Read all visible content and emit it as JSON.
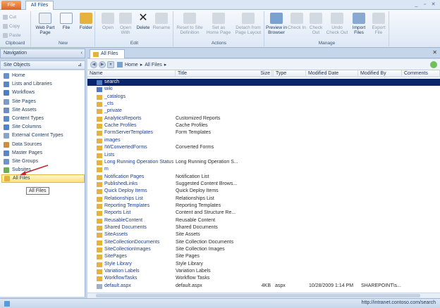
{
  "window": {
    "file_tab": "File",
    "active_tab": "All Files",
    "minimize": "_",
    "restore": "▫",
    "close": "✕",
    "help": "?"
  },
  "ribbon": {
    "clipboard": {
      "label": "Clipboard",
      "cut": "Cut",
      "copy": "Copy",
      "paste": "Paste"
    },
    "new": {
      "label": "New",
      "web_part_page": "Web Part Page",
      "file": "File",
      "folder": "Folder"
    },
    "edit": {
      "label": "Edit",
      "open": "Open",
      "open_with": "Open With",
      "delete": "Delete",
      "rename": "Rename"
    },
    "actions": {
      "label": "Actions",
      "reset": "Reset to Site Definition",
      "set_home": "Set as Home Page",
      "detach": "Detach from Page Layout"
    },
    "manage": {
      "label": "Manage",
      "preview": "Preview in Browser",
      "check_in": "Check In",
      "check_out": "Check Out",
      "undo_check_out": "Undo Check Out",
      "import": "Import Files",
      "export": "Export File"
    }
  },
  "nav": {
    "title": "Navigation",
    "site_objects": "Site Objects",
    "items": [
      {
        "label": "Home",
        "color": "#6b8fc8"
      },
      {
        "label": "Lists and Libraries",
        "color": "#5a86c2"
      },
      {
        "label": "Workflows",
        "color": "#4d7fbf"
      },
      {
        "label": "Site Pages",
        "color": "#7a9ccc"
      },
      {
        "label": "Site Assets",
        "color": "#6d8fc0"
      },
      {
        "label": "Content Types",
        "color": "#5c8acb"
      },
      {
        "label": "Site Columns",
        "color": "#4f84c9"
      },
      {
        "label": "External Content Types",
        "color": "#8aa4c8"
      },
      {
        "label": "Data Sources",
        "color": "#d08c3a"
      },
      {
        "label": "Master Pages",
        "color": "#5b86c4"
      },
      {
        "label": "Site Groups",
        "color": "#6f94c7"
      },
      {
        "label": "Subsites",
        "color": "#6fae55"
      },
      {
        "label": "All Files",
        "color": "#e6b23e"
      }
    ],
    "tooltip": "All Files"
  },
  "main": {
    "tab_label": "All Files",
    "breadcrumb": [
      "Home",
      "All Files"
    ],
    "columns": [
      "Name",
      "Title",
      "Size",
      "Type",
      "Modified Date",
      "Modified By",
      "Comments"
    ],
    "rows": [
      {
        "name": "search",
        "title": "",
        "kind": "page",
        "selected": true
      },
      {
        "name": "wiki",
        "title": "",
        "kind": "page"
      },
      {
        "name": "_catalogs",
        "title": "",
        "kind": "folder"
      },
      {
        "name": "_cts",
        "title": "",
        "kind": "folder"
      },
      {
        "name": "_private",
        "title": "",
        "kind": "folder"
      },
      {
        "name": "AnalyticsReports",
        "title": "Customized Reports",
        "kind": "folder"
      },
      {
        "name": "Cache Profiles",
        "title": "Cache Profiles",
        "kind": "folder"
      },
      {
        "name": "FormServerTemplates",
        "title": "Form Templates",
        "kind": "folder"
      },
      {
        "name": "images",
        "title": "",
        "kind": "folder"
      },
      {
        "name": "IWConvertedForms",
        "title": "Converted Forms",
        "kind": "folder"
      },
      {
        "name": "Lists",
        "title": "",
        "kind": "folder"
      },
      {
        "name": "Long Running Operation Status",
        "title": "Long Running Operation S...",
        "kind": "folder"
      },
      {
        "name": "m",
        "title": "",
        "kind": "folder"
      },
      {
        "name": "Notification Pages",
        "title": "Notification List",
        "kind": "folder"
      },
      {
        "name": "PublishedLinks",
        "title": "Suggested Content Brows...",
        "kind": "folder"
      },
      {
        "name": "Quick Deploy Items",
        "title": "Quick Deploy Items",
        "kind": "folder"
      },
      {
        "name": "Relationships List",
        "title": "Relationships List",
        "kind": "folder"
      },
      {
        "name": "Reporting Templates",
        "title": "Reporting Templates",
        "kind": "folder"
      },
      {
        "name": "Reports List",
        "title": "Content and Structure Re...",
        "kind": "folder"
      },
      {
        "name": "ReusableContent",
        "title": "Reusable Content",
        "kind": "folder"
      },
      {
        "name": "Shared Documents",
        "title": "Shared Documents",
        "kind": "folder"
      },
      {
        "name": "SiteAssets",
        "title": "Site Assets",
        "kind": "folder"
      },
      {
        "name": "SiteCollectionDocuments",
        "title": "Site Collection Documents",
        "kind": "folder"
      },
      {
        "name": "SiteCollectionImages",
        "title": "Site Collection Images",
        "kind": "folder"
      },
      {
        "name": "SitePages",
        "title": "Site Pages",
        "kind": "folder"
      },
      {
        "name": "Style Library",
        "title": "Style Library",
        "kind": "folder"
      },
      {
        "name": "Variation Labels",
        "title": "Variation Labels",
        "kind": "folder"
      },
      {
        "name": "WorkflowTasks",
        "title": "Workflow Tasks",
        "kind": "folder"
      },
      {
        "name": "default.aspx",
        "title": "default.aspx",
        "kind": "file",
        "size": "4KB",
        "type": "aspx",
        "modified": "10/28/2009 1:14 PM",
        "modified_by": "SHAREPOINT\\s..."
      }
    ]
  },
  "status": {
    "url": "http://intranet.contoso.com/search"
  },
  "colors": {
    "folder": "#e6b23e",
    "page": "#4f7cc0",
    "selection": "#0a246a"
  }
}
